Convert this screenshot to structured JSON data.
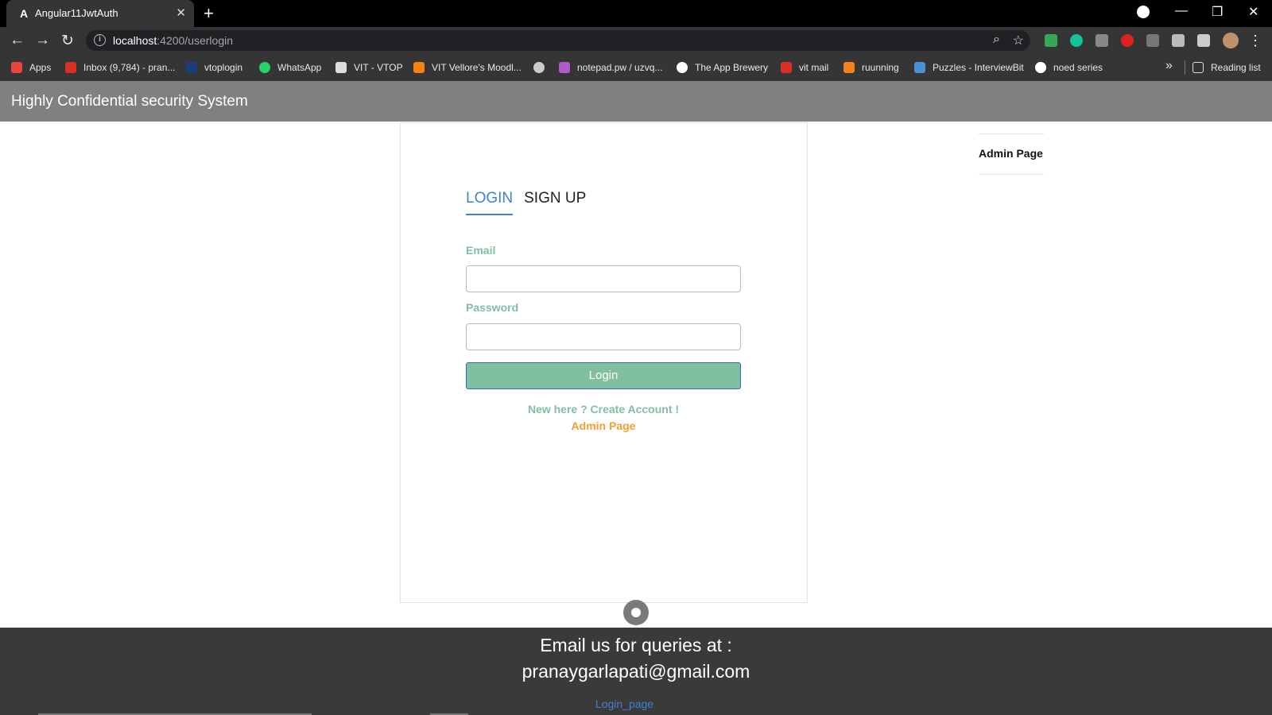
{
  "browser": {
    "tab_title": "Angular11JwtAuth",
    "url_host": "localhost",
    "url_path": ":4200/userlogin",
    "bookmarks": [
      {
        "label": "Apps",
        "color": "#e8453c"
      },
      {
        "label": "Inbox (9,784) - pran...",
        "color": "#d93025"
      },
      {
        "label": "vtoplogin",
        "color": "#1a3d7c"
      },
      {
        "label": "WhatsApp",
        "color": "#25d366"
      },
      {
        "label": "VIT - VTOP",
        "color": "#dddddd"
      },
      {
        "label": "VIT Vellore's Moodl...",
        "color": "#f98012"
      },
      {
        "label": "",
        "color": "#cccccc"
      },
      {
        "label": "notepad.pw / uzvq...",
        "color": "#b05cc8"
      },
      {
        "label": "The App Brewery",
        "color": "#ffffff"
      },
      {
        "label": "vit mail",
        "color": "#d93025"
      },
      {
        "label": "ruunning",
        "color": "#f4801a"
      },
      {
        "label": "Puzzles - InterviewBit",
        "color": "#4c8fd6"
      },
      {
        "label": "noed series",
        "color": "#ffffff"
      }
    ],
    "reading_list": "Reading list",
    "more": "»"
  },
  "app": {
    "header_title": "Highly Confidential security System"
  },
  "login_card": {
    "tabs": {
      "login": "LOGIN",
      "signup": "SIGN UP"
    },
    "email_label": "Email",
    "email_value": "",
    "password_label": "Password",
    "password_value": "",
    "login_button": "Login",
    "create_account": "New here ? Create Account !",
    "admin_link": "Admin Page"
  },
  "sidebar": {
    "admin_page": "Admin Page"
  },
  "footer": {
    "line1": "Email us for queries at :",
    "line2": "pranaygarlapati@gmail.com",
    "link": "Login_page"
  }
}
